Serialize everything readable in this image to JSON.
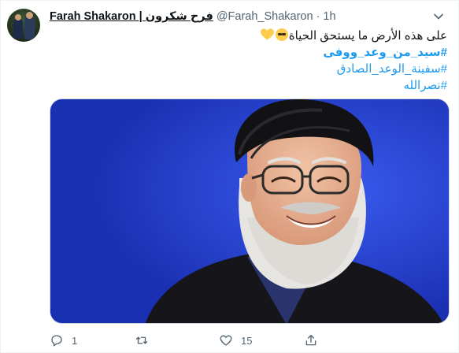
{
  "tweet": {
    "display_name": "Farah Shakaron | فرح شكرون",
    "handle": "@Farah_Shakaron",
    "separator": "·",
    "time": "1h",
    "text_line1": "على هذه الأرض ما يستحق الحياة",
    "hashtags": [
      "#سيد_من_وعد_ووفى",
      "#سفينة_الوعد_الصادق",
      "#نصرالله"
    ],
    "media_background": "#1e3cd0"
  },
  "actions": {
    "reply_count": "1",
    "retweet_count": "",
    "like_count": "15",
    "share_count": ""
  },
  "icons": [
    "more-caret-icon",
    "reply-icon",
    "retweet-icon",
    "like-icon",
    "share-icon"
  ],
  "colors": {
    "link": "#1d9bf0",
    "muted": "#536471",
    "text": "#0f1419"
  }
}
